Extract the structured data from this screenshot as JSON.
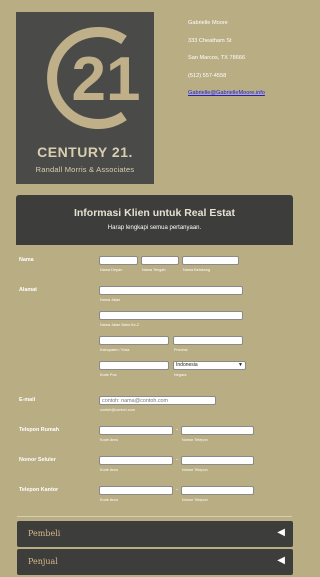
{
  "header": {
    "logo": {
      "numeral": "21",
      "brand": "CENTURY 21.",
      "subtitle": "Randall Morris & Associates",
      "colors": {
        "background": "#4a4a48",
        "gold": "#bfb089"
      }
    },
    "contact": {
      "name": "Gabrielle Moore",
      "street": "333 Cheatham St",
      "city": "San Marcos, TX 78666",
      "phone": "(512) 557-4558",
      "email": "Gabrielle@GabrielleMoore.info"
    }
  },
  "form": {
    "title": "Informasi Klien untuk Real Estat",
    "subtitle": "Harap lengkapi semua pertanyaan.",
    "name": {
      "label": "Nama",
      "first_hint": "Nama Depan",
      "middle_hint": "Nama Tengah",
      "last_hint": "Nama Belakang",
      "first": "",
      "middle": "",
      "last": ""
    },
    "address": {
      "label": "Alamat",
      "street_hint": "Nama Jalan",
      "street2_hint": "Nama Jalan Baris Ke-2",
      "city_hint": "Kabupaten / Kota",
      "province_hint": "Provinsi",
      "zip_hint": "Kode Pos",
      "country_hint": "Negara",
      "country_value": "Indonesia"
    },
    "email": {
      "label": "E-mail",
      "placeholder": "contoh: nama@contoh.com",
      "hint": "contoh@contoh.com"
    },
    "phones": [
      {
        "label": "Telepon Rumah",
        "area_hint": "Kode Area",
        "number_hint": "Nomor Telepon"
      },
      {
        "label": "Nomor Seluler",
        "area_hint": "Kode Area",
        "number_hint": "Nomor Telepon"
      },
      {
        "label": "Telepon Kantor",
        "area_hint": "Kode Area",
        "number_hint": "Nomor Telepon"
      }
    ],
    "phone_separator": "-",
    "sections": [
      {
        "label": "Pembeli",
        "arrow": "◀"
      },
      {
        "label": "Penjual",
        "arrow": "◀"
      }
    ]
  }
}
